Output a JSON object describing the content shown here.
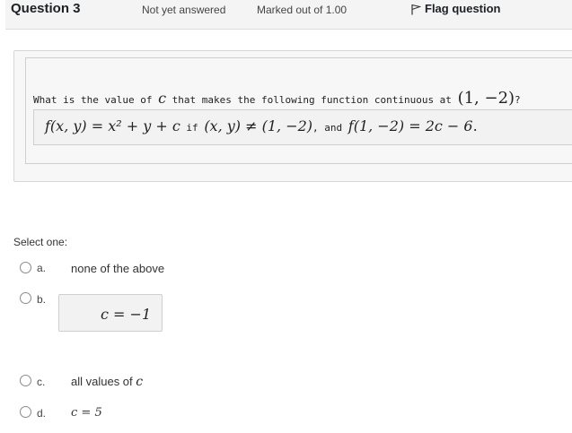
{
  "question_info": {
    "title": "Question 3",
    "state": "Not yet answered",
    "grade": "Marked out of 1.00",
    "flag_label": "Flag question",
    "flag_icon": "flag-icon"
  },
  "question_text": {
    "prefix": "What is the value of ",
    "var": "c",
    "middle": " that makes the following function continuous at ",
    "point": "(1, −2)",
    "suffix": "?",
    "function_lhs": "f(x, y) = x² + y + c",
    "if_word": " if ",
    "condition": "(x, y) ≠ (1, −2)",
    "and_word": ", and ",
    "value_at_point": "f(1, −2) = 2c − 6",
    "end": "."
  },
  "answer": {
    "prompt": "Select one:",
    "options": [
      {
        "letter": "a.",
        "text": "none of the above"
      },
      {
        "letter": "b.",
        "text": "c = −1"
      },
      {
        "letter": "c.",
        "text": "all values of ",
        "var": "c"
      },
      {
        "letter": "d.",
        "text": "c = 5"
      }
    ]
  }
}
